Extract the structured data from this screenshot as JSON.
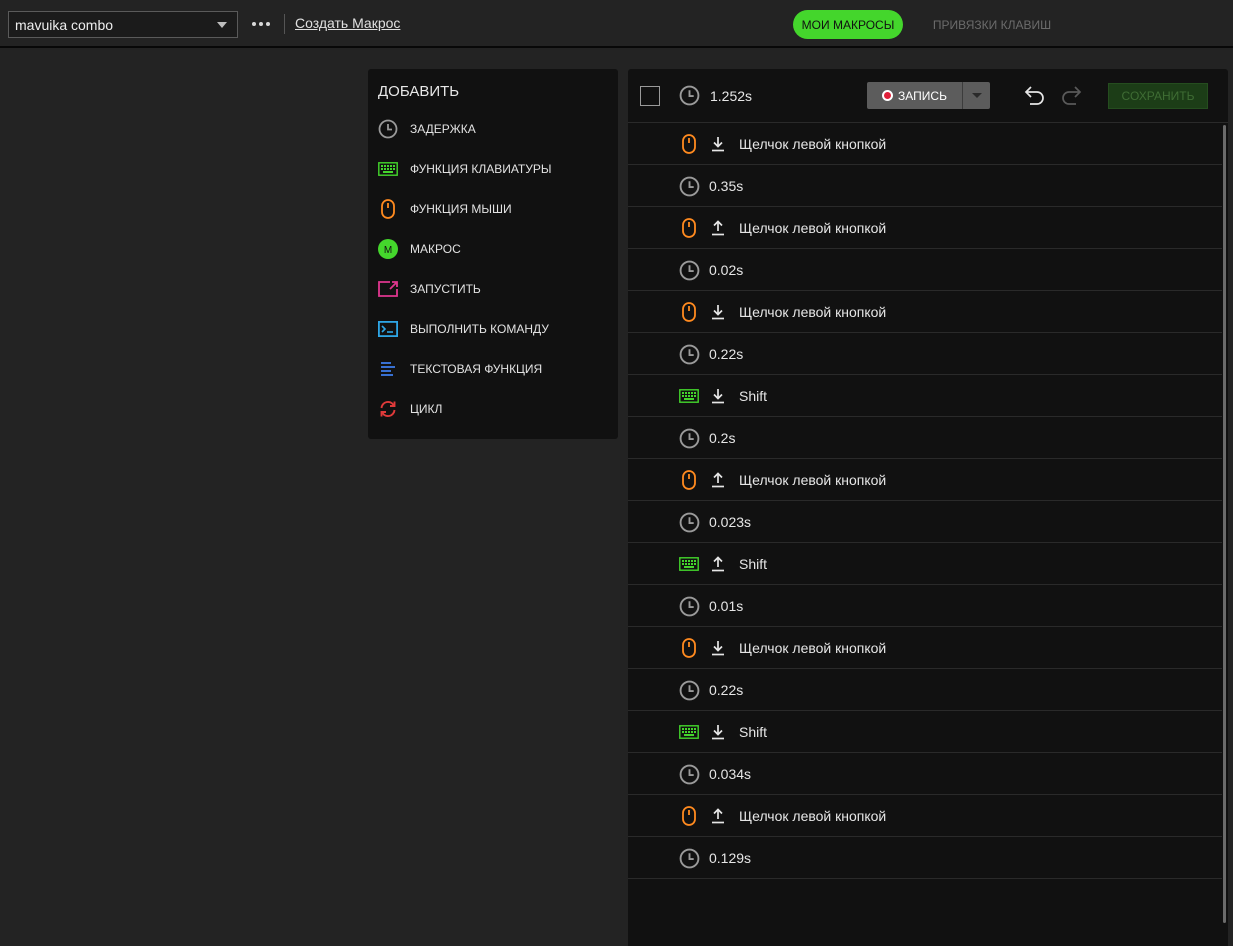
{
  "topbar": {
    "macro_name": "mavuika combo",
    "create_link": "Создать Макрос",
    "tab_my_macros": "МОИ МАКРОСЫ",
    "tab_keybinds": "ПРИВЯЗКИ КЛАВИШ"
  },
  "add_panel": {
    "title": "ДОБАВИТЬ",
    "items": [
      {
        "label": "ЗАДЕРЖКА",
        "icon": "clock-icon",
        "color": "#9a9a9a"
      },
      {
        "label": "ФУНКЦИЯ КЛАВИАТУРЫ",
        "icon": "keyboard-icon",
        "color": "#44d62c"
      },
      {
        "label": "ФУНКЦИЯ МЫШИ",
        "icon": "mouse-icon",
        "color": "#ff8a1f"
      },
      {
        "label": "МАКРОС",
        "icon": "macro-icon",
        "color": "#44d62c"
      },
      {
        "label": "ЗАПУСТИТЬ",
        "icon": "launch-icon",
        "color": "#e0368f"
      },
      {
        "label": "ВЫПОЛНИТЬ КОМАНДУ",
        "icon": "command-icon",
        "color": "#2ea6e6"
      },
      {
        "label": "ТЕКСТОВАЯ ФУНКЦИЯ",
        "icon": "text-icon",
        "color": "#3d7be8"
      },
      {
        "label": "ЦИКЛ",
        "icon": "loop-icon",
        "color": "#e03a3a"
      }
    ],
    "macro_badge": "M"
  },
  "editor": {
    "total_time": "1.252s",
    "record_label": "ЗАПИСЬ",
    "save_label": "СОХРАНИТЬ",
    "events": [
      {
        "type": "mouse",
        "dir": "down",
        "text": "Щелчок левой кнопкой"
      },
      {
        "type": "delay",
        "text": "0.35s"
      },
      {
        "type": "mouse",
        "dir": "up",
        "text": "Щелчок левой кнопкой"
      },
      {
        "type": "delay",
        "text": "0.02s"
      },
      {
        "type": "mouse",
        "dir": "down",
        "text": "Щелчок левой кнопкой"
      },
      {
        "type": "delay",
        "text": "0.22s"
      },
      {
        "type": "keyboard",
        "dir": "down",
        "text": "Shift"
      },
      {
        "type": "delay",
        "text": "0.2s"
      },
      {
        "type": "mouse",
        "dir": "up",
        "text": "Щелчок левой кнопкой"
      },
      {
        "type": "delay",
        "text": "0.023s"
      },
      {
        "type": "keyboard",
        "dir": "up",
        "text": "Shift"
      },
      {
        "type": "delay",
        "text": "0.01s"
      },
      {
        "type": "mouse",
        "dir": "down",
        "text": "Щелчок левой кнопкой"
      },
      {
        "type": "delay",
        "text": "0.22s"
      },
      {
        "type": "keyboard",
        "dir": "down",
        "text": "Shift"
      },
      {
        "type": "delay",
        "text": "0.034s"
      },
      {
        "type": "mouse",
        "dir": "up",
        "text": "Щелчок левой кнопкой"
      },
      {
        "type": "delay",
        "text": "0.129s"
      }
    ]
  },
  "colors": {
    "accent": "#44d62c",
    "mouse": "#ff8a1f",
    "keyboard": "#44d62c",
    "delay": "#9a9a9a",
    "record": "#e0203a"
  }
}
